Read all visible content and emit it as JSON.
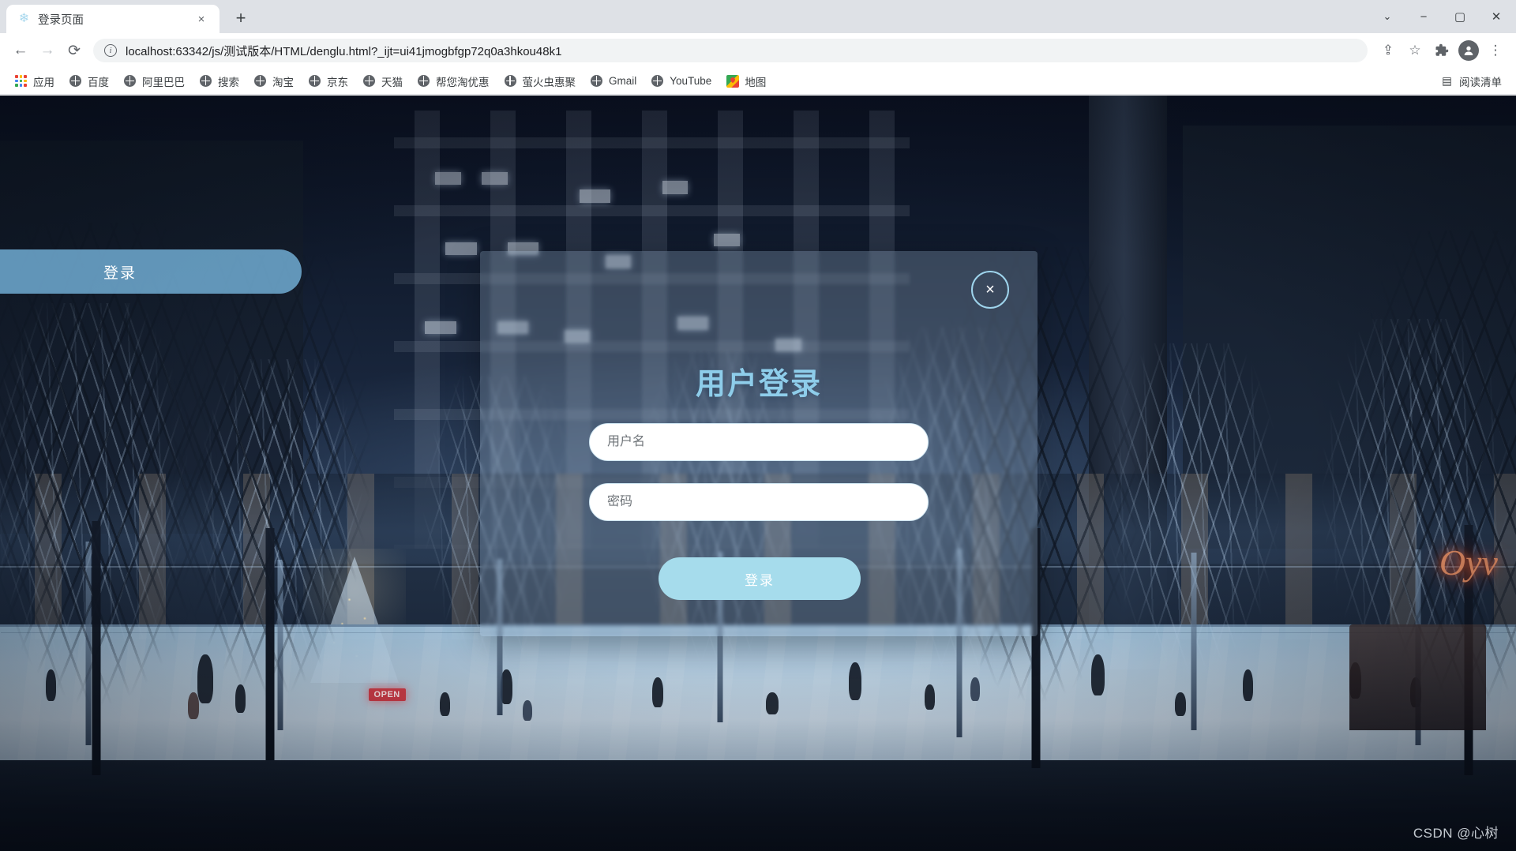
{
  "browser": {
    "tab": {
      "title": "登录页面",
      "favicon_icon": "snowflake-icon",
      "close_icon": "×"
    },
    "new_tab_icon": "+",
    "window_controls": {
      "chevron_icon": "⌄",
      "minimize_icon": "−",
      "maximize_icon": "▢",
      "close_icon": "✕"
    },
    "nav": {
      "back_icon": "←",
      "forward_icon": "→",
      "reload_icon": "⟳"
    },
    "omnibox": {
      "info_icon": "i",
      "url_host": "localhost:63342",
      "url_path": "/js/测试版本/HTML/denglu.html?_ijt=ui41jmogbfgp72q0a3hkou48k1",
      "url_full": "localhost:63342/js/测试版本/HTML/denglu.html?_ijt=ui41jmogbfgp72q0a3hkou48k1"
    },
    "toolbar_icons": [
      {
        "name": "share-icon",
        "glyph": "⇪"
      },
      {
        "name": "bookmark-star-icon",
        "glyph": "☆"
      },
      {
        "name": "extensions-puzzle-icon",
        "glyph": "🧩"
      },
      {
        "name": "profile-avatar-icon",
        "glyph": "●"
      },
      {
        "name": "more-menu-icon",
        "glyph": "⋮"
      }
    ],
    "bookmarks": [
      {
        "label": "应用",
        "icon": "apps-grid-icon"
      },
      {
        "label": "百度",
        "icon": "globe-icon"
      },
      {
        "label": "阿里巴巴",
        "icon": "globe-icon"
      },
      {
        "label": "搜索",
        "icon": "globe-icon"
      },
      {
        "label": "淘宝",
        "icon": "globe-icon"
      },
      {
        "label": "京东",
        "icon": "globe-icon"
      },
      {
        "label": "天猫",
        "icon": "globe-icon"
      },
      {
        "label": "帮您淘优惠",
        "icon": "globe-icon"
      },
      {
        "label": "萤火虫惠聚",
        "icon": "globe-icon"
      },
      {
        "label": "Gmail",
        "icon": "globe-icon"
      },
      {
        "label": "YouTube",
        "icon": "globe-icon"
      },
      {
        "label": "地图",
        "icon": "map-pin-icon"
      }
    ],
    "reading_list": {
      "label": "阅读清单",
      "icon": "reading-list-icon",
      "glyph": "▤"
    }
  },
  "page": {
    "side_login_button": "登录",
    "modal": {
      "close_label": "×",
      "title": "用户登录",
      "username_placeholder": "用户名",
      "password_placeholder": "密码",
      "submit_label": "登录"
    },
    "scene": {
      "open_sign": "OPEN",
      "neon_sign": "Oyv"
    },
    "watermark": "CSDN @心树"
  },
  "colors": {
    "accent_blue": "#8ecdea",
    "button_blue": "#a6dcec",
    "side_pill_blue": "#78b9e1",
    "chrome_bg": "#dee1e6",
    "omnibox_bg": "#f1f3f4"
  }
}
